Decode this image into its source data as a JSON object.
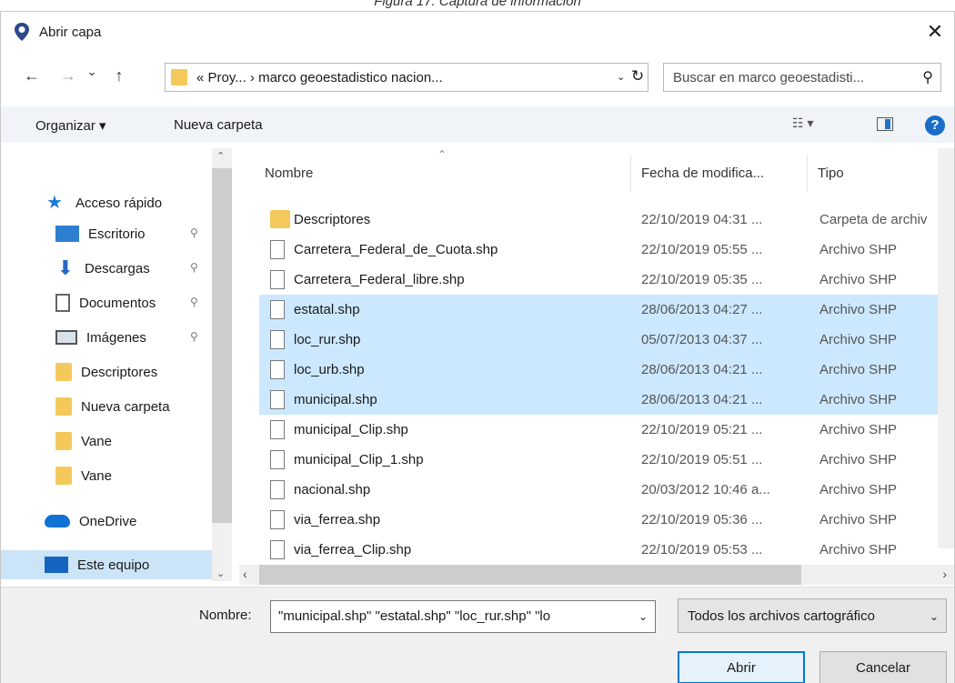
{
  "caption": "Figura 17. Captura de información",
  "dialog": {
    "title": "Abrir capa",
    "close_glyph": "✕"
  },
  "nav": {
    "back": "←",
    "forward": "→",
    "recent": "⌄",
    "up": "↑",
    "breadcrumb": "«  Proy...  ›  marco geoestadistico nacion...",
    "dropdown": "⌄",
    "refresh": "↻",
    "search_placeholder": "Buscar en marco geoestadisti...",
    "search_icon": "⚲"
  },
  "toolbar": {
    "organize": "Organizar ▾",
    "new_folder": "Nueva carpeta",
    "view_menu": "☷ ▾",
    "help": "?"
  },
  "sidebar": {
    "items": [
      {
        "label": "Acceso rápido",
        "icon": "star-icon",
        "pinned": false
      },
      {
        "label": "Escritorio",
        "icon": "desktop-icon",
        "pinned": true
      },
      {
        "label": "Descargas",
        "icon": "download-icon",
        "pinned": true
      },
      {
        "label": "Documentos",
        "icon": "document-icon",
        "pinned": true
      },
      {
        "label": "Imágenes",
        "icon": "image-icon",
        "pinned": true
      },
      {
        "label": "Descriptores",
        "icon": "folder-icon",
        "pinned": false
      },
      {
        "label": "Nueva carpeta",
        "icon": "folder-icon",
        "pinned": false
      },
      {
        "label": "Vane",
        "icon": "folder-icon",
        "pinned": false
      },
      {
        "label": "Vane",
        "icon": "folder-icon",
        "pinned": false
      },
      {
        "label": "OneDrive",
        "icon": "cloud-icon",
        "pinned": false
      },
      {
        "label": "Este equipo",
        "icon": "monitor-icon",
        "pinned": false
      }
    ],
    "pin_glyph": "📌"
  },
  "columns": {
    "name": "Nombre",
    "date": "Fecha de modifica...",
    "type": "Tipo"
  },
  "files": [
    {
      "name": "Descriptores",
      "date": "22/10/2019 04:31 ...",
      "type": "Carpeta de archiv",
      "folder": true,
      "selected": false
    },
    {
      "name": "Carretera_Federal_de_Cuota.shp",
      "date": "22/10/2019 05:55 ...",
      "type": "Archivo SHP",
      "folder": false,
      "selected": false
    },
    {
      "name": "Carretera_Federal_libre.shp",
      "date": "22/10/2019 05:35 ...",
      "type": "Archivo SHP",
      "folder": false,
      "selected": false
    },
    {
      "name": "estatal.shp",
      "date": "28/06/2013 04:27 ...",
      "type": "Archivo SHP",
      "folder": false,
      "selected": true
    },
    {
      "name": "loc_rur.shp",
      "date": "05/07/2013 04:37 ...",
      "type": "Archivo SHP",
      "folder": false,
      "selected": true
    },
    {
      "name": "loc_urb.shp",
      "date": "28/06/2013 04:21 ...",
      "type": "Archivo SHP",
      "folder": false,
      "selected": true
    },
    {
      "name": "municipal.shp",
      "date": "28/06/2013 04:21 ...",
      "type": "Archivo SHP",
      "folder": false,
      "selected": true
    },
    {
      "name": "municipal_Clip.shp",
      "date": "22/10/2019 05:21 ...",
      "type": "Archivo SHP",
      "folder": false,
      "selected": false
    },
    {
      "name": "municipal_Clip_1.shp",
      "date": "22/10/2019 05:51 ...",
      "type": "Archivo SHP",
      "folder": false,
      "selected": false
    },
    {
      "name": "nacional.shp",
      "date": "20/03/2012 10:46 a...",
      "type": "Archivo SHP",
      "folder": false,
      "selected": false
    },
    {
      "name": "via_ferrea.shp",
      "date": "22/10/2019 05:36 ...",
      "type": "Archivo SHP",
      "folder": false,
      "selected": false
    },
    {
      "name": "via_ferrea_Clip.shp",
      "date": "22/10/2019 05:53 ...",
      "type": "Archivo SHP",
      "folder": false,
      "selected": false
    }
  ],
  "bottom": {
    "name_label": "Nombre:",
    "name_value": "\"municipal.shp\" \"estatal.shp\" \"loc_rur.shp\" \"lo",
    "filter_value": "Todos los archivos cartográfico",
    "open_button": "Abrir",
    "cancel_button": "Cancelar"
  },
  "colors": {
    "selection": "#cce8ff",
    "accent": "#0078d7",
    "folder": "#f4c95c"
  }
}
